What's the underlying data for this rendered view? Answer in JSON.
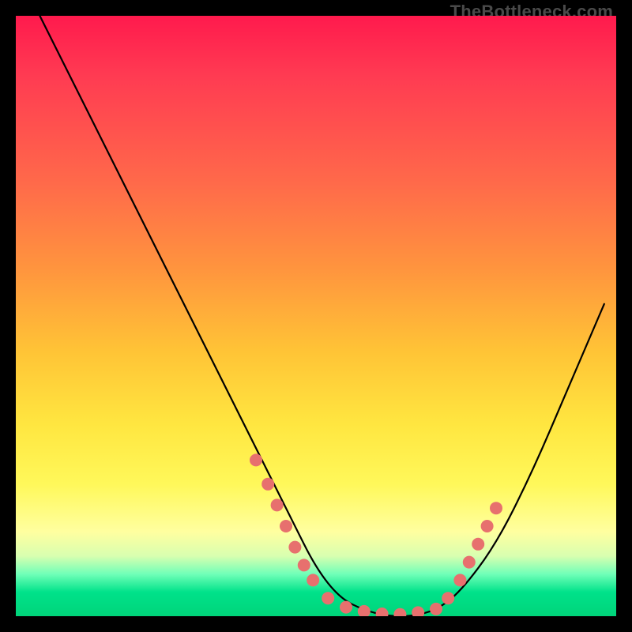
{
  "watermark": "TheBottleneck.com",
  "colors": {
    "dot": "#e7706e",
    "curve": "#000000",
    "frame": "#000000"
  },
  "chart_data": {
    "type": "line",
    "title": "",
    "xlabel": "",
    "ylabel": "",
    "xlim": [
      0,
      100
    ],
    "ylim": [
      0,
      100
    ],
    "grid": false,
    "legend": false,
    "series": [
      {
        "name": "bottleneck-curve",
        "x": [
          4,
          10,
          16,
          22,
          28,
          34,
          40,
          46,
          50,
          54,
          58,
          62,
          66,
          70,
          74,
          80,
          86,
          92,
          98
        ],
        "y": [
          100,
          88,
          76,
          64,
          52,
          40,
          28,
          16,
          8,
          3,
          1,
          0,
          0,
          1,
          4,
          12,
          24,
          38,
          52
        ]
      }
    ],
    "markers": [
      {
        "x": 40,
        "y": 26
      },
      {
        "x": 42,
        "y": 22
      },
      {
        "x": 43.5,
        "y": 18.5
      },
      {
        "x": 45,
        "y": 15
      },
      {
        "x": 46.5,
        "y": 11.5
      },
      {
        "x": 48,
        "y": 8.5
      },
      {
        "x": 49.5,
        "y": 6
      },
      {
        "x": 52,
        "y": 3
      },
      {
        "x": 55,
        "y": 1.5
      },
      {
        "x": 58,
        "y": 0.8
      },
      {
        "x": 61,
        "y": 0.4
      },
      {
        "x": 64,
        "y": 0.3
      },
      {
        "x": 67,
        "y": 0.6
      },
      {
        "x": 70,
        "y": 1.2
      },
      {
        "x": 72,
        "y": 3
      },
      {
        "x": 74,
        "y": 6
      },
      {
        "x": 75.5,
        "y": 9
      },
      {
        "x": 77,
        "y": 12
      },
      {
        "x": 78.5,
        "y": 15
      },
      {
        "x": 80,
        "y": 18
      }
    ]
  }
}
